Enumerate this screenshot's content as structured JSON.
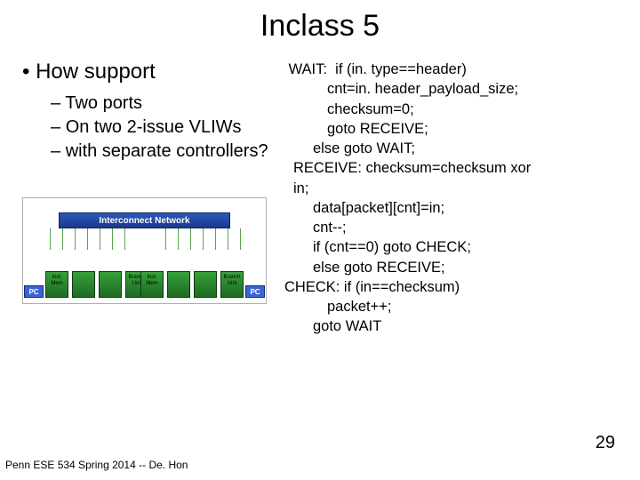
{
  "title": "Inclass 5",
  "left": {
    "main": "How support",
    "subs": [
      "Two ports",
      "On  two 2-issue VLIWs",
      "with separate controllers?"
    ]
  },
  "code": {
    "l1": " WAIT:  if (in. type==header)",
    "l2": "cnt=in. header_payload_size;",
    "l3": "checksum=0;",
    "l4": "goto RECEIVE;",
    "l5": "else goto WAIT;",
    "l6": "RECEIVE: checksum=checksum xor",
    "l7": "in;",
    "l8": "data[packet][cnt]=in;",
    "l9": "cnt--;",
    "l10": "if (cnt==0) goto CHECK;",
    "l11": "else goto RECEIVE;",
    "l12": "CHECK: if (in==checksum)",
    "l13": "packet++;",
    "l14": "goto WAIT"
  },
  "diagram": {
    "interconnect": "Interconnect Network",
    "mem": "Inst. Mem",
    "bu": "Branch Unit",
    "pc": "PC"
  },
  "footer": "Penn ESE 534 Spring 2014 -- De. Hon",
  "slidenum": "29"
}
